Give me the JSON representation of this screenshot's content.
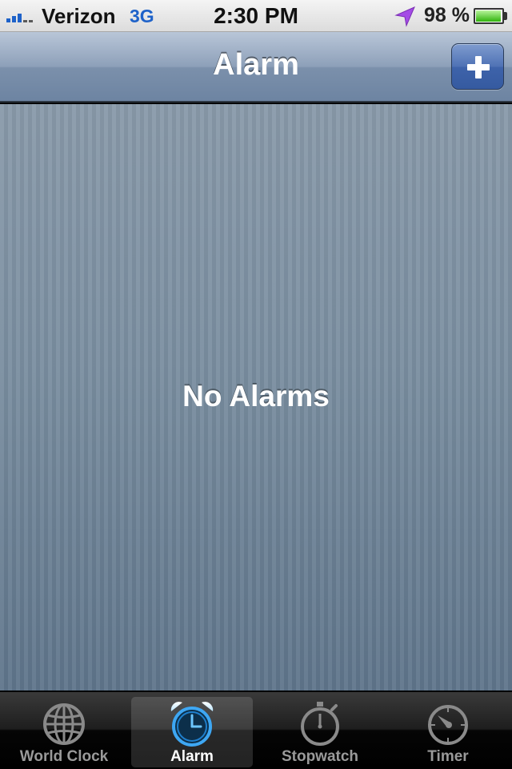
{
  "status_bar": {
    "carrier": "Verizon",
    "network": "3G",
    "time": "2:30 PM",
    "battery_percent": "98 %",
    "battery_level": 0.98,
    "signal_bars": 3,
    "signal_bars_total": 5,
    "location_icon": "location-arrow-icon"
  },
  "nav_bar": {
    "title": "Alarm",
    "add_button_icon": "plus-icon"
  },
  "content": {
    "empty_message": "No Alarms"
  },
  "tab_bar": {
    "tabs": [
      {
        "label": "World Clock",
        "icon": "globe-icon",
        "selected": false
      },
      {
        "label": "Alarm",
        "icon": "alarm-clock-icon",
        "selected": true
      },
      {
        "label": "Stopwatch",
        "icon": "stopwatch-icon",
        "selected": false
      },
      {
        "label": "Timer",
        "icon": "timer-icon",
        "selected": false
      }
    ]
  },
  "colors": {
    "accent_blue": "#1e62c9",
    "selected_icon_blue": "#3ea7f3",
    "battery_green": "#2fb30c",
    "location_purple": "#a44be6"
  }
}
